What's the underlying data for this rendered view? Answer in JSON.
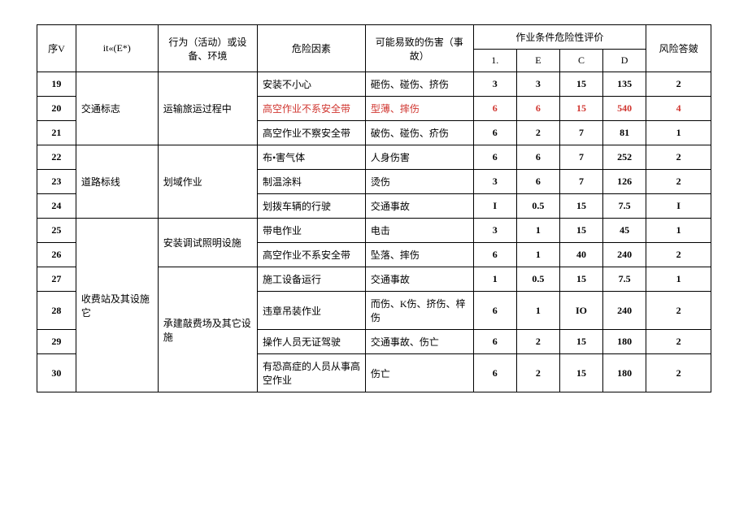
{
  "headers": {
    "seq": "序V",
    "name": "it«(E*)",
    "activity": "行为（活动）或设备、环境",
    "risk": "危险因素",
    "harm": "可能易致的伤害（事故）",
    "evalGroup": "作业条件危险性评价",
    "l": "1.",
    "e": "E",
    "c": "C",
    "d": "D",
    "level": "风险答皴"
  },
  "rows": [
    {
      "seq": "19",
      "name": "交通标志",
      "nameSpan": 3,
      "act": "运输旅运过程中",
      "actSpan": 3,
      "risk": "安装不小心",
      "harm": "砸伤、碰伤、挤伤",
      "l": "3",
      "e": "3",
      "c": "15",
      "d": "135",
      "lv": "2",
      "red": false
    },
    {
      "seq": "20",
      "risk": "高空作业不系安全带",
      "harm": "型薄、摔伤",
      "l": "6",
      "e": "6",
      "c": "15",
      "d": "540",
      "lv": "4",
      "red": true
    },
    {
      "seq": "21",
      "risk": "高空作业不察安全带",
      "harm": "破伤、碰伤、疥伤",
      "l": "6",
      "e": "2",
      "c": "7",
      "d": "81",
      "lv": "1",
      "red": false
    },
    {
      "seq": "22",
      "name": "道路标线",
      "nameSpan": 3,
      "act": "划域作业",
      "actSpan": 3,
      "risk": "布•害气体",
      "harm": "人身伤害",
      "l": "6",
      "e": "6",
      "c": "7",
      "d": "252",
      "lv": "2",
      "red": false
    },
    {
      "seq": "23",
      "risk": "制温涂料",
      "harm": "烫伤",
      "l": "3",
      "e": "6",
      "c": "7",
      "d": "126",
      "lv": "2",
      "red": false
    },
    {
      "seq": "24",
      "risk": "划拨车辆的行驶",
      "harm": "交通事故",
      "l": "I",
      "e": "0.5",
      "c": "15",
      "d": "7.5",
      "lv": "I",
      "red": false
    },
    {
      "seq": "25",
      "name": "收费站及其设施它",
      "nameSpan": 6,
      "act": "安装调试照明设施",
      "actSpan": 2,
      "risk": "带电作业",
      "harm": "电击",
      "l": "3",
      "e": "1",
      "c": "15",
      "d": "45",
      "lv": "1",
      "red": false
    },
    {
      "seq": "26",
      "risk": "高空作业不系安全带",
      "harm": "坠落、摔伤",
      "l": "6",
      "e": "1",
      "c": "40",
      "d": "240",
      "lv": "2",
      "red": false
    },
    {
      "seq": "27",
      "act": "承建敲费场及其它设施",
      "actSpan": 4,
      "risk": "施工设备运行",
      "harm": "交通事故",
      "l": "1",
      "e": "0.5",
      "c": "15",
      "d": "7.5",
      "lv": "1",
      "red": false
    },
    {
      "seq": "28",
      "risk": "违章吊装作业",
      "harm": "而伤、K伤、挤伤、梓伤",
      "l": "6",
      "e": "1",
      "c": "IO",
      "d": "240",
      "lv": "2",
      "red": false
    },
    {
      "seq": "29",
      "risk": "操作人员无证驾驶",
      "harm": "交通事故、伤亡",
      "l": "6",
      "e": "2",
      "c": "15",
      "d": "180",
      "lv": "2",
      "red": false
    },
    {
      "seq": "30",
      "risk": "有恐高症的人员从事高空作业",
      "harm": "伤亡",
      "l": "6",
      "e": "2",
      "c": "15",
      "d": "180",
      "lv": "2",
      "red": false
    }
  ]
}
